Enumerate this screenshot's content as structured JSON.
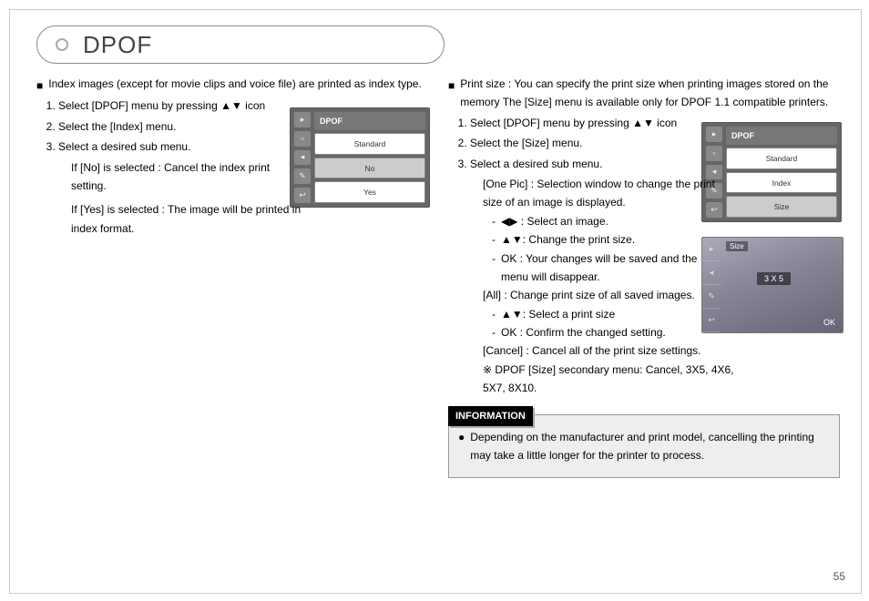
{
  "heading": "DPOF",
  "pageNumber": "55",
  "left": {
    "intro": "Index images (except for movie clips and voice file) are printed as index type.",
    "step1": "Select [DPOF] menu by pressing ▲▼ icon",
    "step2": "Select the [Index] menu.",
    "step3": "Select a desired sub menu.",
    "noLine": "If [No] is selected : Cancel the index print setting.",
    "yesLine": "If [Yes] is selected : The image will be printed in index format.",
    "fig": {
      "head": "DPOF",
      "rows": [
        "Standard",
        "No",
        "Yes"
      ]
    }
  },
  "right": {
    "intro": "Print size : You can specify the print size when printing images stored on the memory The [Size] menu is available only for DPOF 1.1 compatible printers.",
    "step1": "Select [DPOF] menu by pressing ▲▼ icon",
    "step2": "Select the [Size] menu.",
    "step3": "Select a desired sub menu.",
    "onePic": "[One Pic] : Selection window to change the print size of an image is displayed.",
    "d1": "◀▶ : Select an image.",
    "d2": "▲▼: Change the print size.",
    "d3": "OK : Your changes will be saved and the menu will disappear.",
    "all": "[All] : Change print size of all saved images.",
    "a1": "▲▼: Select a print size",
    "a2": "OK : Confirm the changed setting.",
    "cancel": "[Cancel] : Cancel all of the print size settings.",
    "note": "※ DPOF [Size] secondary menu: Cancel, 3X5, 4X6, 5X7, 8X10.",
    "fig": {
      "head": "DPOF",
      "rows": [
        "Standard",
        "Index",
        "Size"
      ]
    },
    "photo": {
      "label": "Size",
      "value": "3 X 5",
      "ok": "OK"
    }
  },
  "info": {
    "label": "INFORMATION",
    "text": "Depending on the manufacturer and print model, cancelling the printing may take a little longer for the printer to process."
  }
}
